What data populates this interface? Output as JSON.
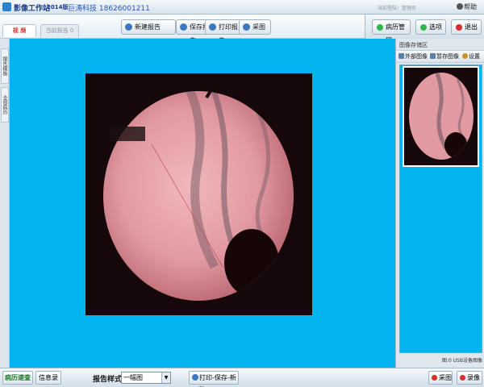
{
  "titlebar": {
    "app_title": "影像工作站",
    "edition": "2014版",
    "company": "巨涛科技  18626001211",
    "current_user": "当前登陆：管理员",
    "help_label": "帮助"
  },
  "tabs": [
    {
      "label": "视 频"
    },
    {
      "label": "当前报告 0"
    }
  ],
  "toolbar": {
    "new_report": "新建报告",
    "save_report": "保存报告",
    "print_report": "打印报告",
    "capture": "采图"
  },
  "top_right": {
    "case_management": "病历管理",
    "options": "选项",
    "exit": "退出"
  },
  "left_tabs": [
    {
      "label": "报告模板"
    },
    {
      "label": "全部病历"
    }
  ],
  "image_panel": {
    "title": "图像存储区",
    "external_image": "外部图像",
    "video_record": "暂存图像",
    "settings": "设置",
    "status": "图:0  USB设备图像"
  },
  "bottombar": {
    "quick_entry": "病历速查",
    "info_entry": "信息录入",
    "report_style_label": "报告样式:",
    "report_style_value": "一幅图",
    "print_save_new": "打印-保存-新建",
    "capture": "采图",
    "record": "录像"
  },
  "colors": {
    "viewer_bg": "#00b4f0",
    "scope_bg": "#16080a",
    "tissue": "#e4a2a8",
    "record_red": "#d6302a",
    "case_green": "#2fb84a"
  }
}
